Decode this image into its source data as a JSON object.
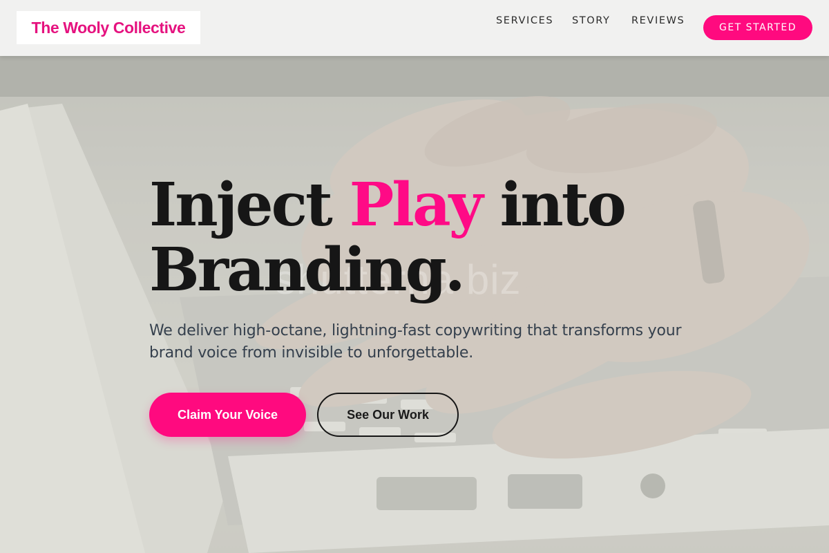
{
  "header": {
    "logo": "The Wooly Collective",
    "nav": [
      {
        "label": "SERVICES"
      },
      {
        "label": "STORY"
      },
      {
        "label": "REVIEWS"
      }
    ],
    "cta_label": "GET STARTED"
  },
  "hero": {
    "title_part1": "Inject ",
    "title_accent": "Play",
    "title_part2": " into Branding.",
    "subtitle": "We deliver high-octane, lightning-fast copywriting that transforms your brand voice from invisible to unforgettable.",
    "primary_button": "Claim Your Voice",
    "secondary_button": "See Our Work",
    "watermark": "shutterna biz"
  },
  "colors": {
    "accent": "#ff0a7f",
    "logo_text": "#e5127f",
    "heading": "#161616",
    "body_text": "#35404d"
  }
}
